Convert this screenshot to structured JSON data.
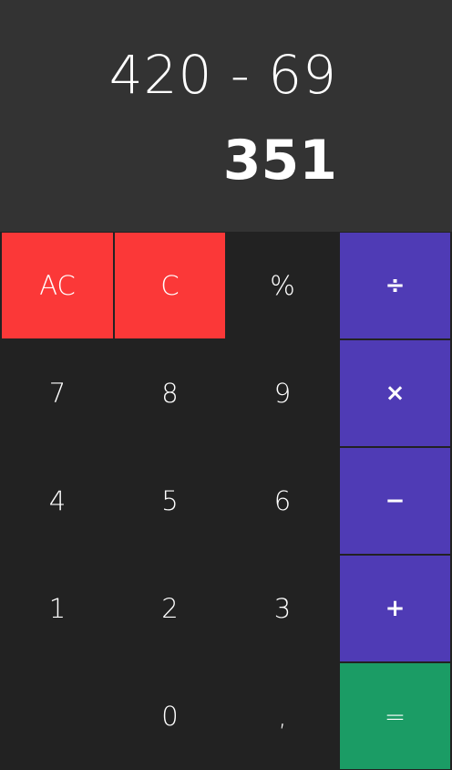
{
  "display": {
    "expression": "420 - 69",
    "result": "351"
  },
  "keys": {
    "all_clear": "AC",
    "clear": "C",
    "percent": "%",
    "divide": "÷",
    "seven": "7",
    "eight": "8",
    "nine": "9",
    "multiply": "×",
    "four": "4",
    "five": "5",
    "six": "6",
    "subtract": "−",
    "one": "1",
    "two": "2",
    "three": "3",
    "add": "+",
    "zero": "0",
    "decimal": ",",
    "equals": "="
  },
  "colors": {
    "clear_keys": "#fb3838",
    "operator_keys": "#4f3bb5",
    "equals_key": "#1b9c65",
    "keypad_background": "#222222",
    "display_background": "#333333"
  }
}
